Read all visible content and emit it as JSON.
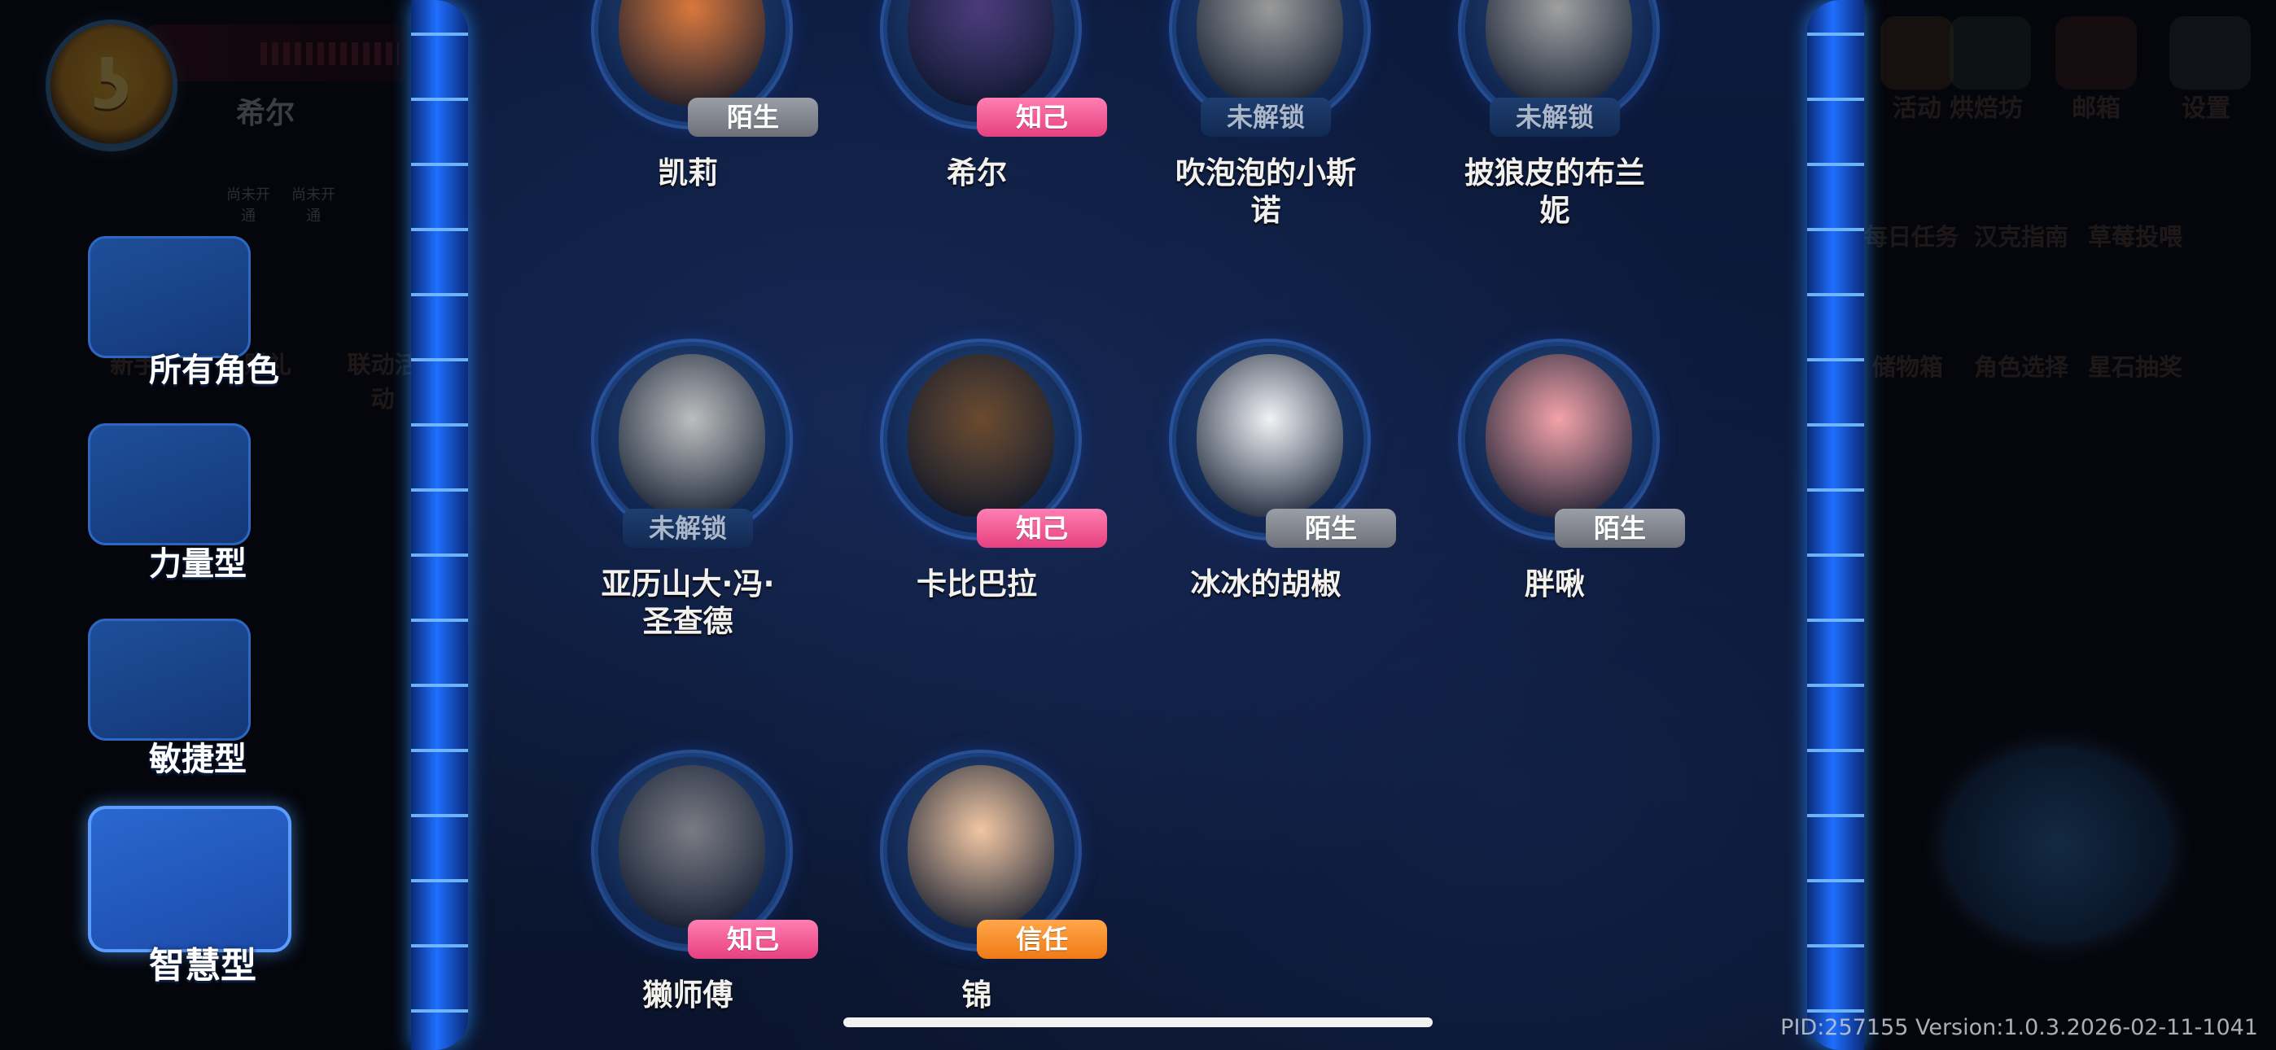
{
  "hud": {
    "player_name": "希尔",
    "not_open_1": "尚未开通",
    "not_open_2": "尚未开通",
    "left_tiles": [
      "新手",
      "赠礼",
      "联动活动"
    ],
    "right_top": [
      "活动",
      "烘焙坊",
      "邮箱",
      "设置"
    ],
    "right_mid": [
      "每日任务",
      "汉克指南",
      "草莓投喂"
    ],
    "right_bot": [
      "储物箱",
      "角色选择",
      "星石抽奖"
    ]
  },
  "categories": [
    {
      "label": "所有角色",
      "icon": "group-icon"
    },
    {
      "label": "力量型",
      "icon": "fist-icon"
    },
    {
      "label": "敏捷型",
      "icon": "winged-boot-icon"
    },
    {
      "label": "智慧型",
      "icon": "eye-helmet-icon",
      "selected": true
    }
  ],
  "characters": [
    {
      "name": "凯莉",
      "status": "陌生",
      "kind": "stranger",
      "locked": false,
      "color": "#d9773b"
    },
    {
      "name": "希尔",
      "status": "知己",
      "kind": "friend",
      "locked": false,
      "color": "#4b3a7a"
    },
    {
      "name": "吹泡泡的小斯诺",
      "status": "未解锁",
      "kind": "locked",
      "locked": true,
      "color": "#9a9a9a"
    },
    {
      "name": "披狼皮的布兰妮",
      "status": "未解锁",
      "kind": "locked",
      "locked": true,
      "color": "#a0a0a0"
    },
    {
      "name": "亚历山大·冯·圣查德",
      "status": "未解锁",
      "kind": "locked",
      "locked": true,
      "color": "#bdbdbd"
    },
    {
      "name": "卡比巴拉",
      "status": "知己",
      "kind": "friend",
      "locked": false,
      "color": "#6b4a2e"
    },
    {
      "name": "冰冰的胡椒",
      "status": "陌生",
      "kind": "stranger",
      "locked": false,
      "color": "#f2f2f5"
    },
    {
      "name": "胖啾",
      "status": "陌生",
      "kind": "stranger",
      "locked": false,
      "color": "#f3a2a8"
    },
    {
      "name": "獭师傅",
      "status": "知己",
      "kind": "friend",
      "locked": false,
      "color": "#7a7a82"
    },
    {
      "name": "锦",
      "status": "信任",
      "kind": "trust",
      "locked": false,
      "color": "#f1c6a2"
    }
  ],
  "version": "PID:257155  Version:1.0.3.2026-02-11-1041"
}
